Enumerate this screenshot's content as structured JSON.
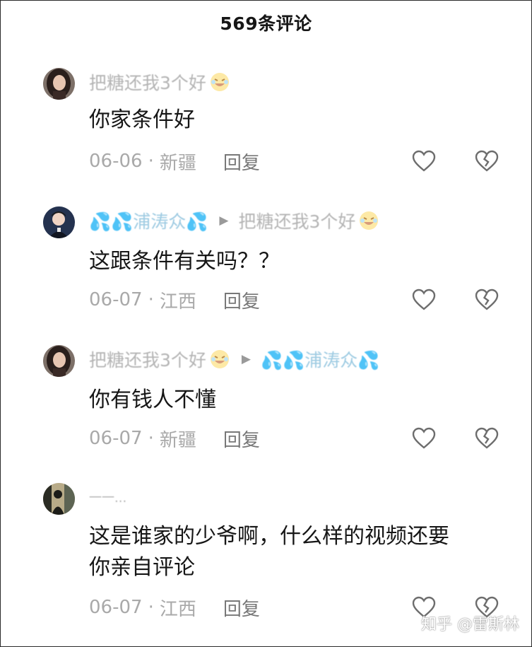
{
  "header": {
    "title": "569条评论"
  },
  "reply_label": "回复",
  "comments": [
    {
      "avatar": "woman-avatar",
      "author": "把糖还我3个好",
      "reply_to": "",
      "text_lines": [
        "你家条件好"
      ],
      "date": "06-06",
      "location": "新疆"
    },
    {
      "avatar": "child-avatar",
      "author": "💦💦浦涛众💦",
      "reply_to": "把糖还我3个好",
      "text_lines": [
        "这跟条件有关吗？？"
      ],
      "date": "06-07",
      "location": "江西"
    },
    {
      "avatar": "woman-avatar",
      "author": "把糖还我3个好",
      "reply_to": "💦💦浦涛众💦",
      "text_lines": [
        "你有钱人不懂"
      ],
      "date": "06-07",
      "location": "新疆"
    },
    {
      "avatar": "man-avatar",
      "author": "一一...",
      "reply_to": "",
      "text_lines": [
        "这是谁家的少爷啊，什么样的视频还要",
        "你亲自评论"
      ],
      "date": "06-07",
      "location": "江西"
    }
  ],
  "watermark": "知乎 @雷斯林",
  "colors": {
    "text": "#161616",
    "meta": "#a9a9a9",
    "reply": "#787878",
    "icon": "#6d6d6d"
  }
}
